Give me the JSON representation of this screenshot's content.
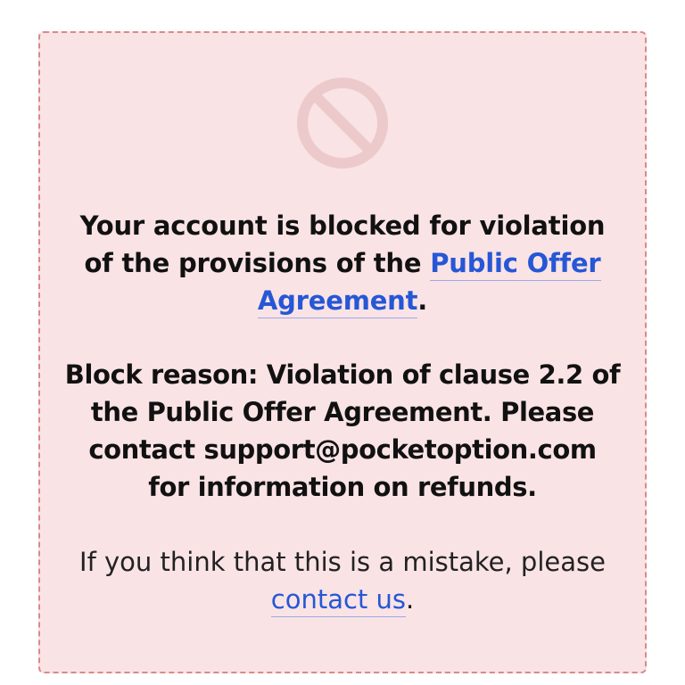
{
  "icon": "ban-icon",
  "colors": {
    "panel_background": "#fae3e5",
    "panel_border": "#d98a8a",
    "link": "#2557d6",
    "icon": "#eccacb"
  },
  "notice": {
    "message_prefix": "Your account is blocked for violation of the provisions of the ",
    "message_link": "Public Offer Agreement",
    "message_suffix": ".",
    "block_reason": "Block reason: Violation of clause 2.2 of the Public Offer Agreement. Please contact support@pocketoption.com for information on refunds.",
    "mistake_prefix": "If you think that this is a mistake, please ",
    "mistake_link": "contact us",
    "mistake_suffix": "."
  }
}
